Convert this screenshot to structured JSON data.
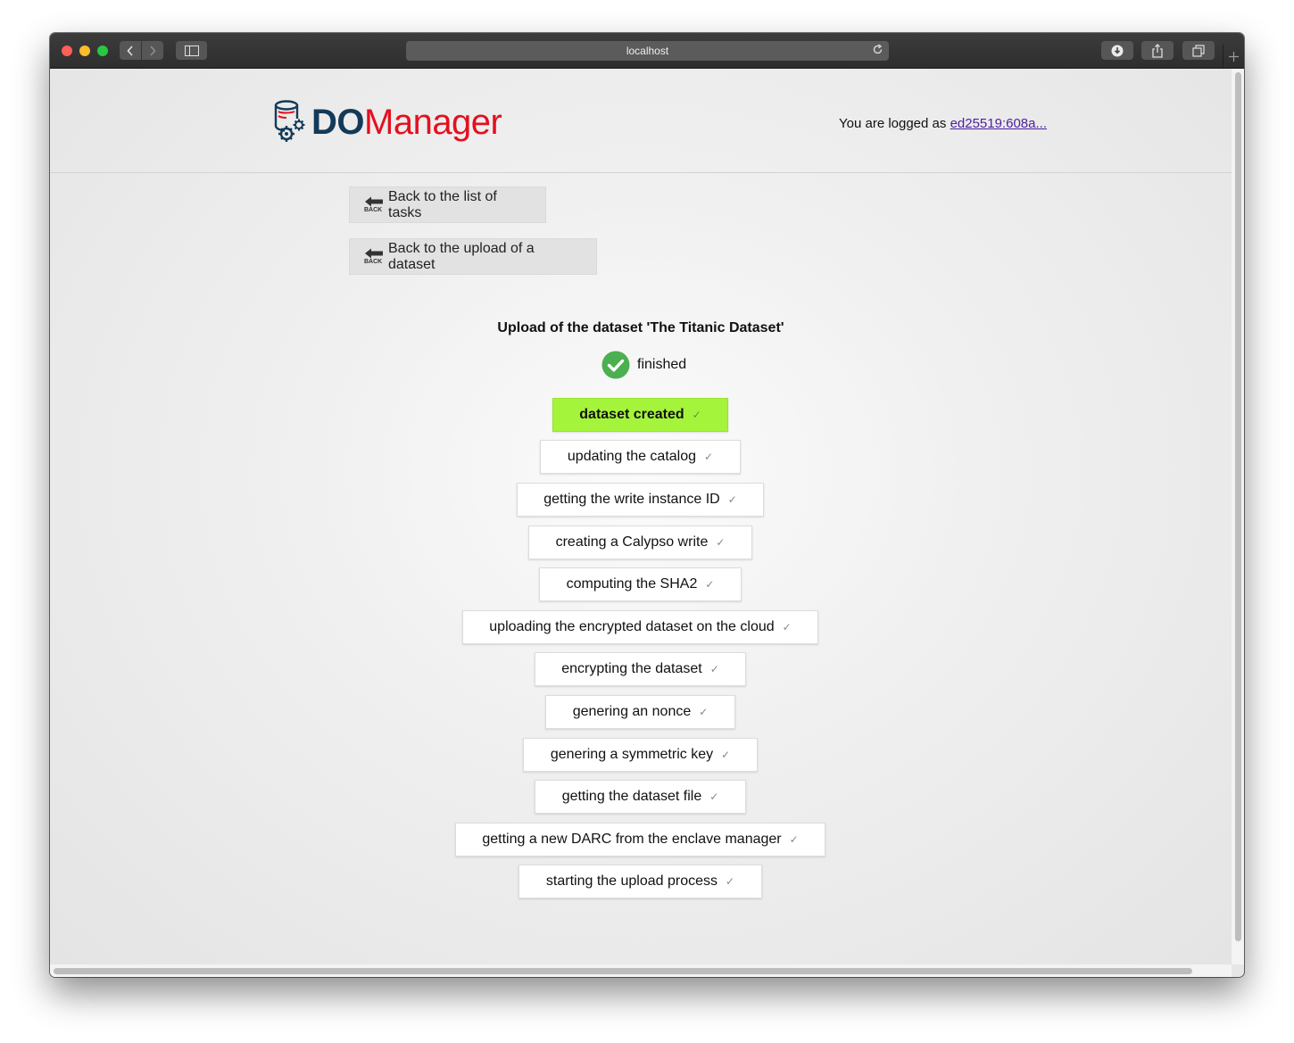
{
  "browser": {
    "url": "localhost"
  },
  "header": {
    "logo_do": "DO",
    "logo_manager": "Manager",
    "login_prefix": "You are logged as ",
    "login_user": "ed25519:608a..."
  },
  "nav": {
    "back_tasks_label": "Back to the list of tasks",
    "back_upload_label": "Back to the upload of a dataset",
    "back_icon_text": "BACK"
  },
  "upload": {
    "title": "Upload of the dataset 'The Titanic Dataset'",
    "status": "finished",
    "check_mark": "✓",
    "steps": [
      "dataset created",
      "updating the catalog",
      "getting the write instance ID",
      "creating a Calypso write",
      "computing the SHA2",
      "uploading the encrypted dataset on the cloud",
      "encrypting the dataset",
      "genering an nonce",
      "genering a symmetric key",
      "getting the dataset file",
      "getting a new DARC from the enclave manager",
      "starting the upload process"
    ]
  },
  "colors": {
    "active_step": "#a5f43c",
    "status_green": "#4caf50",
    "logo_blue": "#133a59",
    "logo_red": "#e3101f"
  }
}
